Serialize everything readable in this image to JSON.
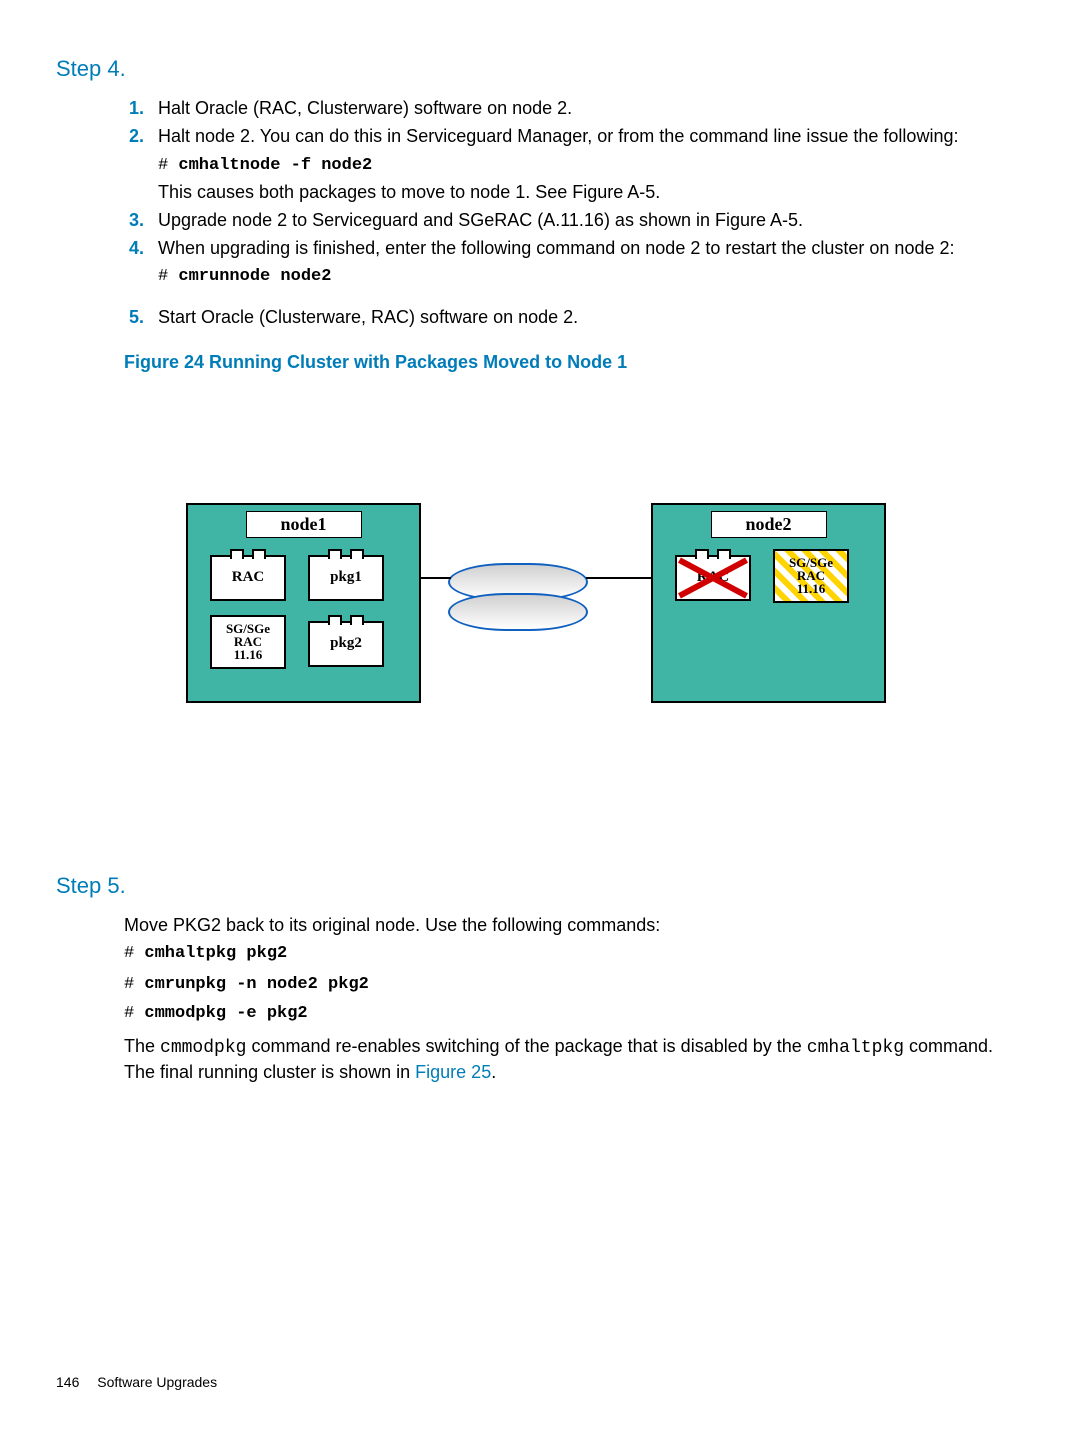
{
  "step4": {
    "heading": "Step 4.",
    "items": [
      {
        "num": "1.",
        "text": "Halt Oracle (RAC, Clusterware) software on node 2."
      },
      {
        "num": "2.",
        "text": "Halt node 2. You can do this in Serviceguard Manager, or from the command line issue the following:",
        "cmd_prefix": "# ",
        "cmd": "cmhaltnode -f node2",
        "after": "This causes both packages to move to node 1. See Figure A-5."
      },
      {
        "num": "3.",
        "text": "Upgrade node 2 to Serviceguard and SGeRAC (A.11.16) as shown in Figure A-5."
      },
      {
        "num": "4.",
        "text": "When upgrading is finished, enter the following command on node 2 to restart the cluster on node 2:",
        "cmd_prefix": "# ",
        "cmd": "cmrunnode node2"
      },
      {
        "num": "5.",
        "text": "Start Oracle (Clusterware, RAC) software on node 2."
      }
    ]
  },
  "figure_caption": "Figure 24 Running Cluster with Packages Moved to Node 1",
  "diagram": {
    "node1_label": "node1",
    "node2_label": "node2",
    "rac": "RAC",
    "pkg1": "pkg1",
    "pkg2": "pkg2",
    "sgrac": "SG/SGe\nRAC\n11.16"
  },
  "step5": {
    "heading": "Step 5.",
    "intro": "Move PKG2 back to its original node. Use the following commands:",
    "cmds": [
      {
        "prefix": "# ",
        "cmd": "cmhaltpkg pkg2"
      },
      {
        "prefix": "# ",
        "cmd": "cmrunpkg -n node2 pkg2"
      },
      {
        "prefix": "# ",
        "cmd": "cmmodpkg -e pkg2"
      }
    ],
    "outro_a": "The ",
    "outro_cmd1": "cmmodpkg",
    "outro_b": " command re-enables switching of the package that is disabled by the ",
    "outro_cmd2": "cmhaltpkg",
    "outro_c": " command. The final running cluster is shown in ",
    "outro_link": "Figure 25",
    "outro_d": "."
  },
  "footer": {
    "page": "146",
    "section": "Software Upgrades"
  }
}
